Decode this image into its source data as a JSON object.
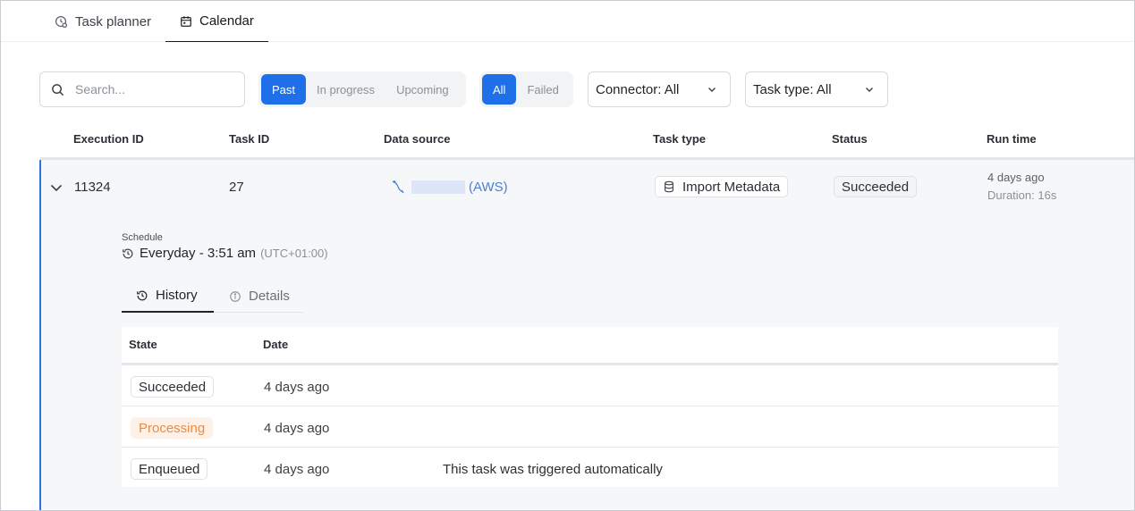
{
  "tabs": [
    {
      "label": "Task planner",
      "icon": "clock-gear-icon",
      "active": false
    },
    {
      "label": "Calendar",
      "icon": "calendar-icon",
      "active": true
    }
  ],
  "filters": {
    "search_placeholder": "Search...",
    "time_segment": [
      {
        "label": "Past",
        "active": true
      },
      {
        "label": "In progress",
        "active": false
      },
      {
        "label": "Upcoming",
        "active": false
      }
    ],
    "status_segment": [
      {
        "label": "All",
        "active": true
      },
      {
        "label": "Failed",
        "active": false
      }
    ],
    "connector": "Connector: All",
    "task_type": "Task type: All"
  },
  "table": {
    "columns": [
      "Execution ID",
      "Task ID",
      "Data source",
      "Task type",
      "Status",
      "Run time"
    ],
    "row": {
      "execution_id": "11324",
      "task_id": "27",
      "data_source_suffix": "(AWS)",
      "task_type": "Import Metadata",
      "status": "Succeeded",
      "run_time": "4 days ago",
      "duration": "Duration: 16s"
    }
  },
  "detail": {
    "schedule_label": "Schedule",
    "schedule_value": "Everyday - 3:51 am",
    "schedule_tz": "(UTC+01:00)",
    "tabs": [
      {
        "label": "History",
        "icon": "history-icon",
        "active": true
      },
      {
        "label": "Details",
        "icon": "info-icon",
        "active": false
      }
    ],
    "history": {
      "columns": [
        "State",
        "Date"
      ],
      "rows": [
        {
          "state": "Succeeded",
          "date": "4 days ago",
          "note": ""
        },
        {
          "state": "Processing",
          "date": "4 days ago",
          "note": ""
        },
        {
          "state": "Enqueued",
          "date": "4 days ago",
          "note": "This task was triggered automatically"
        }
      ]
    }
  },
  "colors": {
    "accent": "#1f6fe8",
    "processing": "#ef8a3c",
    "link": "#4a7fd8"
  }
}
